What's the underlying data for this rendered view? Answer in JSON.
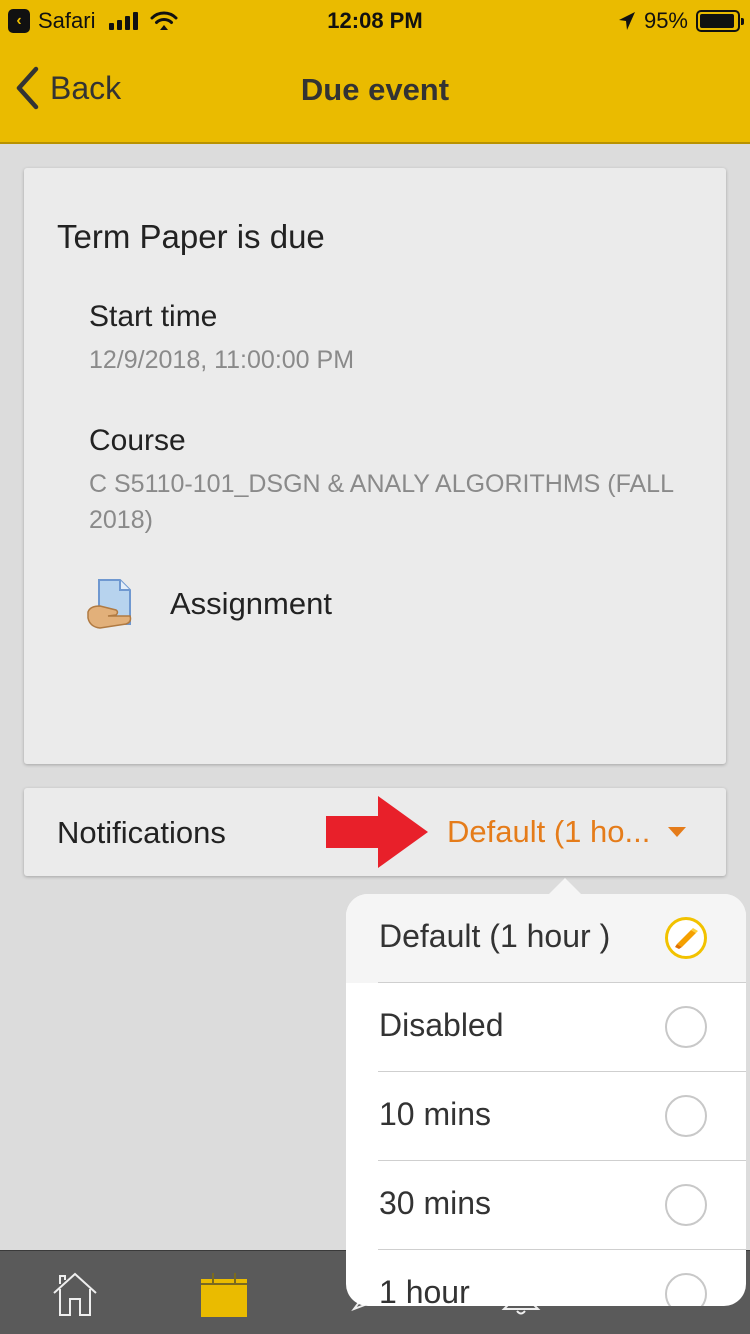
{
  "status_bar": {
    "back_app": "Safari",
    "time": "12:08 PM",
    "battery_percent_label": "95%",
    "battery_level": 0.95,
    "signal_bars": 4
  },
  "header": {
    "back_label": "Back",
    "title": "Due event",
    "accent_color": "#eabb00"
  },
  "event": {
    "title": "Term Paper is due",
    "start_time_label": "Start time",
    "start_time_value": "12/9/2018, 11:00:00 PM",
    "course_label": "Course",
    "course_value": "C S5110-101_DSGN & ANALY ALGORITHMS (FALL 2018)",
    "module_icon": "assignment-icon",
    "module_label": "Assignment"
  },
  "notifications": {
    "label": "Notifications",
    "selected_value": "Default (1 ho...",
    "value_color": "#e57c1a",
    "annotation": "red-arrow"
  },
  "dropdown": {
    "options": [
      {
        "label": "Default (1 hour )",
        "checked": true
      },
      {
        "label": "Disabled",
        "checked": false
      },
      {
        "label": "10 mins",
        "checked": false
      },
      {
        "label": "30 mins",
        "checked": false
      },
      {
        "label": "1 hour",
        "checked": false
      }
    ]
  },
  "tabbar": {
    "tabs": [
      {
        "icon": "home-icon",
        "active": false
      },
      {
        "icon": "calendar-icon",
        "active": true
      },
      {
        "icon": "messages-icon",
        "active": false
      },
      {
        "icon": "bell-icon",
        "active": false
      }
    ],
    "active_color": "#eabb00"
  }
}
